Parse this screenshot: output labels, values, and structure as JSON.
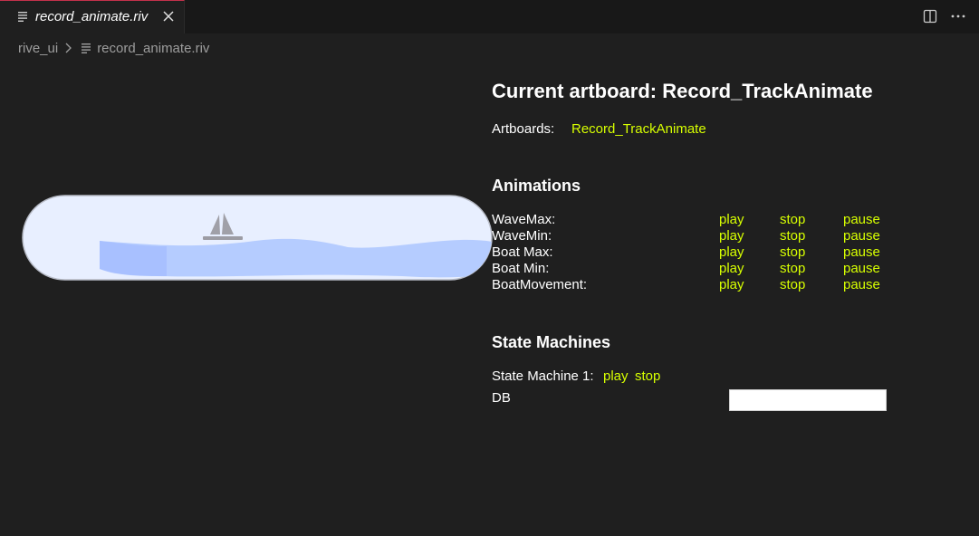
{
  "tab": {
    "title": "record_animate.riv",
    "file_icon": "file-lines-icon",
    "close_icon": "close-icon"
  },
  "editor_actions": {
    "split_icon": "split-editor-icon",
    "more_icon": "more-actions-icon"
  },
  "breadcrumb": {
    "folder": "rive_ui",
    "separator_icon": "chevron-right-icon",
    "file": "record_animate.riv"
  },
  "canvas": {
    "sky_color": "#e8efff",
    "wave_color": "#b5ccff",
    "boat_color": "#a0a0a8"
  },
  "panel": {
    "heading": "Current artboard: Record_TrackAnimate",
    "artboards_label": "Artboards:",
    "artboards": [
      "Record_TrackAnimate"
    ],
    "animations_title": "Animations",
    "animations": [
      {
        "name": "WaveMax:",
        "play": "play",
        "stop": "stop",
        "pause": "pause"
      },
      {
        "name": "WaveMin:",
        "play": "play",
        "stop": "stop",
        "pause": "pause"
      },
      {
        "name": "Boat Max:",
        "play": "play",
        "stop": "stop",
        "pause": "pause"
      },
      {
        "name": "Boat Min:",
        "play": "play",
        "stop": "stop",
        "pause": "pause"
      },
      {
        "name": "BoatMovement:",
        "play": "play",
        "stop": "stop",
        "pause": "pause"
      }
    ],
    "state_machines_title": "State Machines",
    "state_machines": [
      {
        "label": "State Machine 1:",
        "play": "play",
        "stop": "stop"
      }
    ],
    "inputs": [
      {
        "label": "DB",
        "value": ""
      }
    ]
  },
  "colors": {
    "background": "#1f1f1f",
    "link": "#d7ff00",
    "active_tab_border": "#c4314b"
  }
}
